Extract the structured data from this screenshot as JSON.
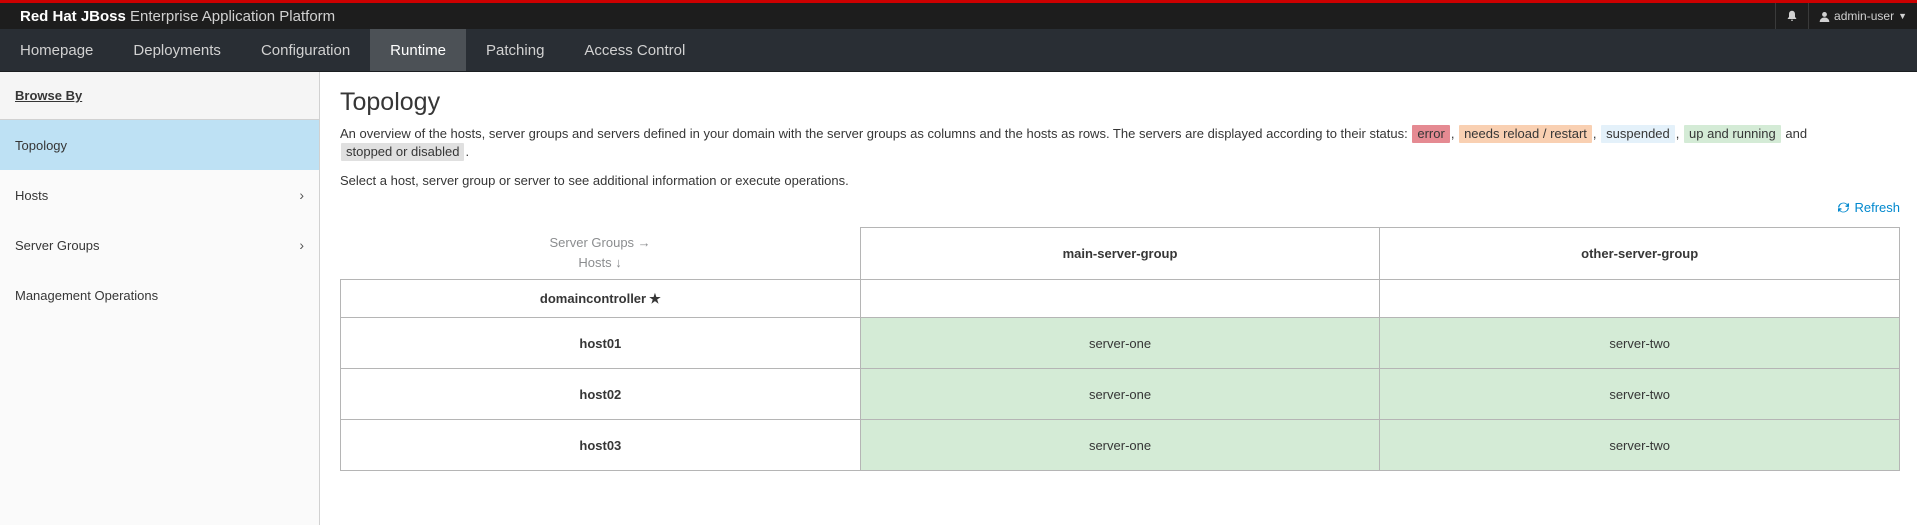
{
  "brand": {
    "bold": "Red Hat JBoss",
    "rest": "Enterprise Application Platform"
  },
  "util": {
    "user": "admin-user"
  },
  "nav": [
    {
      "label": "Homepage"
    },
    {
      "label": "Deployments"
    },
    {
      "label": "Configuration"
    },
    {
      "label": "Runtime"
    },
    {
      "label": "Patching"
    },
    {
      "label": "Access Control"
    }
  ],
  "sidebar": {
    "header": "Browse By",
    "items": [
      {
        "label": "Topology"
      },
      {
        "label": "Hosts"
      },
      {
        "label": "Server Groups"
      },
      {
        "label": "Management Operations"
      }
    ]
  },
  "main": {
    "title": "Topology",
    "desc_prefix": "An overview of the hosts, server groups and servers defined in your domain with the server groups as columns and the hosts as rows. The servers are displayed according to their status:",
    "statuses": {
      "error": "error",
      "reload": "needs reload / restart",
      "suspended": "suspended",
      "running": "up and running",
      "stopped": "stopped or disabled"
    },
    "and": "and",
    "desc2": "Select a host, server group or server to see additional information or execute operations.",
    "refresh": "Refresh"
  },
  "table": {
    "corner_groups": "Server Groups →",
    "corner_hosts": "Hosts ↓",
    "groups": [
      "main-server-group",
      "other-server-group"
    ],
    "hosts": [
      {
        "name": "domaincontroller",
        "servers": [
          "",
          ""
        ]
      },
      {
        "name": "host01",
        "servers": [
          "server-one",
          "server-two"
        ]
      },
      {
        "name": "host02",
        "servers": [
          "server-one",
          "server-two"
        ]
      },
      {
        "name": "host03",
        "servers": [
          "server-one",
          "server-two"
        ]
      }
    ]
  }
}
